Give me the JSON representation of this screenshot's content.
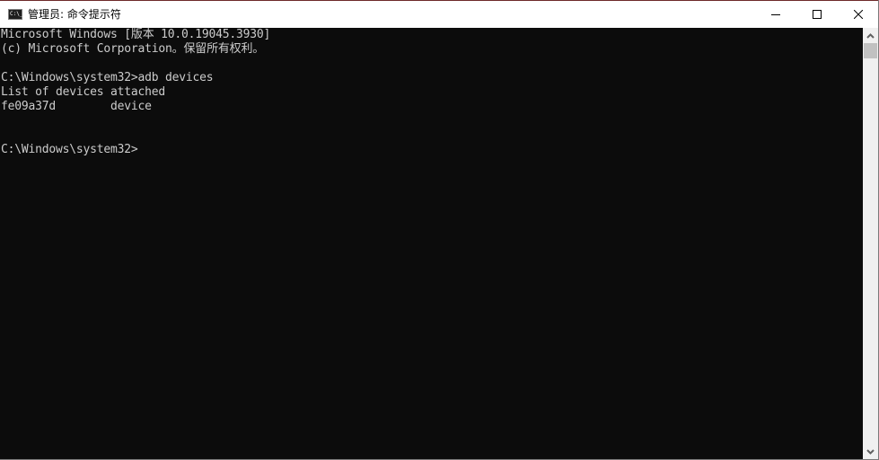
{
  "window": {
    "title": "管理员: 命令提示符",
    "app_icon_text": "C:\\_",
    "controls": {
      "minimize_icon": "minimize-icon",
      "maximize_icon": "maximize-icon",
      "close_icon": "close-icon"
    }
  },
  "console": {
    "lines": [
      "Microsoft Windows [版本 10.0.19045.3930]",
      "(c) Microsoft Corporation。保留所有权利。",
      "",
      "C:\\Windows\\system32>adb devices",
      "List of devices attached",
      "fe09a37d        device",
      "",
      "",
      "C:\\Windows\\system32>"
    ]
  },
  "scrollbar": {
    "up_icon": "chevron-up-icon",
    "down_icon": "chevron-down-icon"
  }
}
